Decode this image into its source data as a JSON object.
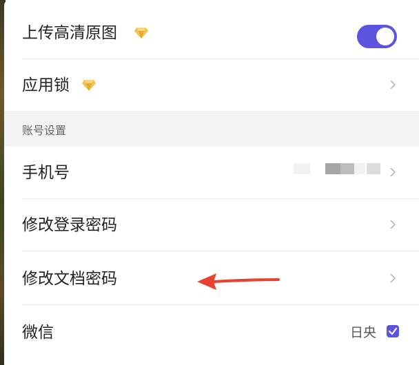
{
  "settings": {
    "upload_hd": {
      "label": "上传高清原图",
      "toggle_on": true
    },
    "app_lock": {
      "label": "应用锁"
    },
    "section_account": "账号设置",
    "phone": {
      "label": "手机号"
    },
    "change_login_password": {
      "label": "修改登录密码"
    },
    "change_doc_password": {
      "label": "修改文档密码"
    },
    "wechat": {
      "label": "微信",
      "value": "日央",
      "checked": true
    }
  },
  "colors": {
    "accent": "#5b54e0",
    "annotation_arrow": "#e8432e",
    "premium_gem": "#f2c14e",
    "section_bg": "#f3f3f5"
  },
  "icons": {
    "premium": "diamond-icon",
    "navigate": "chevron-right-icon",
    "checkbox": "check-icon"
  }
}
